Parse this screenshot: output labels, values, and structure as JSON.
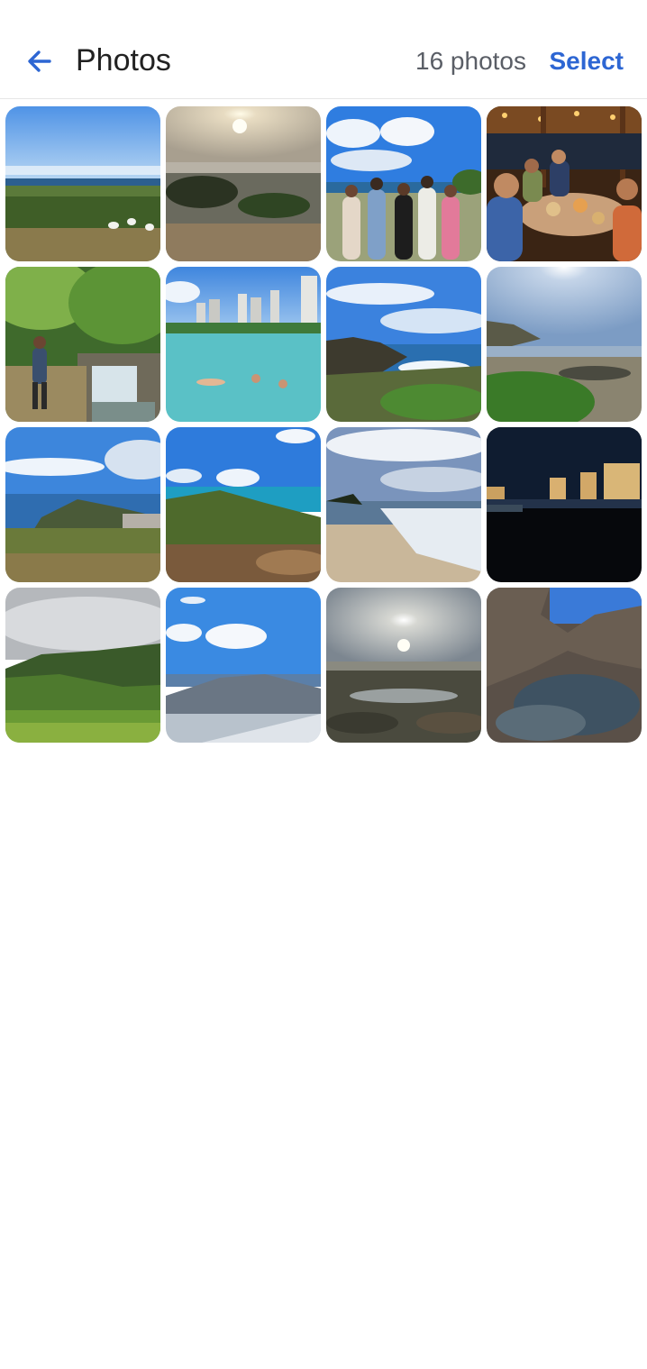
{
  "header": {
    "back_icon": "arrow-left-icon",
    "title": "Photos",
    "count_label": "16 photos",
    "select_label": "Select"
  },
  "colors": {
    "accent": "#2d66d3",
    "sky": "#4f8fe0",
    "ocean": "#2f6fae",
    "grass": "#4e7a2e",
    "night": "#0b1220"
  },
  "photos": [
    {
      "scene": "coastal grass field with white birds and ocean horizon"
    },
    {
      "scene": "sun over rocky shoreline and tide pools"
    },
    {
      "scene": "group of five friends posing by the ocean"
    },
    {
      "scene": "friends dining at a table under a thatched roof"
    },
    {
      "scene": "hikers on a jungle trail beside a small waterfall"
    },
    {
      "scene": "people swimming in a seawall pool near high-rise hotels"
    },
    {
      "scene": "waves crashing on rocky coast under blue sky"
    },
    {
      "scene": "sun above rocky coastline with green shrubs"
    },
    {
      "scene": "bay and crater viewed from a hilltop"
    },
    {
      "scene": "green hill with clouds and blue ocean"
    },
    {
      "scene": "sandy beach with surf and palm trees"
    },
    {
      "scene": "city skyline lights at night over the water"
    },
    {
      "scene": "misty green mountain ridge over a meadow"
    },
    {
      "scene": "aerial view of mountains and city from a plane"
    },
    {
      "scene": "sunset reflected in tide pools"
    },
    {
      "scene": "rock arch over a tide pool"
    }
  ]
}
